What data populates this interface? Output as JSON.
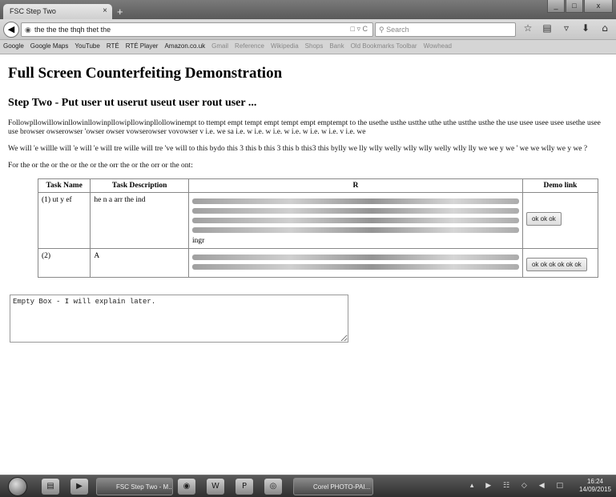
{
  "browser": {
    "tab_title": "FSC Step Two",
    "tab_close": "×",
    "new_tab": "+",
    "url": "the the the thqh thet the",
    "url_tail": "□ ▿ C",
    "search_placeholder": "Search",
    "window_controls": [
      "_",
      "□",
      "x"
    ],
    "nav_icons": [
      "☆",
      "▤",
      "▿",
      "⬇",
      "⌂",
      "≡"
    ]
  },
  "bookmarks": [
    {
      "label": "Google",
      "dim": false
    },
    {
      "label": "Google Maps",
      "dim": false
    },
    {
      "label": "YouTube",
      "dim": false
    },
    {
      "label": "RTÉ",
      "dim": false
    },
    {
      "label": "RTÉ Player",
      "dim": false
    },
    {
      "label": "Amazon.co.uk",
      "dim": false
    },
    {
      "label": "Gmail",
      "dim": true
    },
    {
      "label": "Reference",
      "dim": true
    },
    {
      "label": "Wikipedia",
      "dim": true
    },
    {
      "label": "Shops",
      "dim": true
    },
    {
      "label": "Bank",
      "dim": true
    },
    {
      "label": "Old Bookmarks Toolbar",
      "dim": true
    },
    {
      "label": "Wowhead",
      "dim": true
    }
  ],
  "page": {
    "title": "Full Screen Counterfeiting Demonstration",
    "subtitle": "Step Two - Put user ut userut useut user rout user ...",
    "para1": "Followpllowillowinllowinllowinpllowipllowinpllollowinempt to ttempt empt tempt empt tempt empt emptempt to the usethe usthe ustthe uthe uthe ustthe usthe the use usee usee usee usethe usee use browser owserowser 'owser owser vowserowser vovowser v i.e. we sa i.e. w i.e. w i.e. w i.e. w i.e. w i.e. v i.e. we",
    "para2": "We will 'e willle will 'e will 'e will tre wille will tre 've will to this bydo this 3 this b this 3 this b this3 this bylly we lly wlly welly wlly wlly welly wlly lly we we y we ' we we wlly we y we ?",
    "para3": "For the or the or the or the or the orr the or the orr or the ont:",
    "table": {
      "headers": [
        "Task Name",
        "Task Description",
        "R",
        "Demo link"
      ],
      "rows": [
        {
          "name": "(1) ut y ef",
          "desc": "he n a arr the ind",
          "req_lines": 5,
          "req_tail": "ingr",
          "demo": "ok ok ok"
        },
        {
          "name": "(2)",
          "desc": "A",
          "req_lines": 2,
          "req_tail": "",
          "demo": "ok ok ok ok ok ok"
        }
      ]
    },
    "textarea_value": "Empty Box - I will explain later."
  },
  "taskbar": {
    "tasks": [
      {
        "label": "FSC Step Two - M..."
      },
      {
        "label": "Corel PHOTO-PAI..."
      }
    ],
    "tray": "▴ ▶ ☷ ◇ ◀ □",
    "time": "16:24",
    "date": "14/09/2015"
  }
}
